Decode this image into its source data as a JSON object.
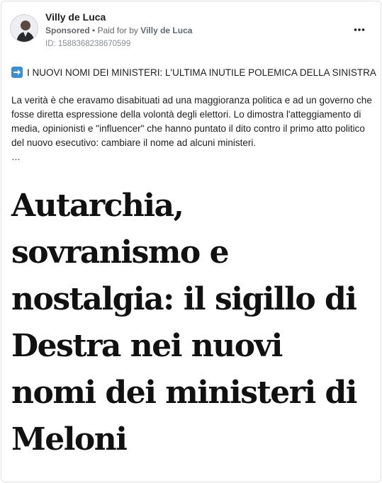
{
  "post": {
    "author": "Villy de Luca",
    "sponsored_label": "Sponsored",
    "paid_for_prefix": "Paid for by",
    "paid_for_name": "Villy de Luca",
    "ad_id": "ID: 1588368238670599",
    "more_icon": "more-horizontal-icon",
    "more_label": "•••",
    "headline_icon": "right-arrow-emoji-icon",
    "headline": "I NUOVI NOMI DEI MINISTERI: L'ULTIMA INUTILE POLEMICA DELLA SINISTRA",
    "body": "La verità è che eravamo disabituati ad una maggioranza politica e ad un governo che fosse diretta espressione della volontà degli elettori. Lo dimostra l'atteggiamento di media, opinionisti e \"influencer\" che hanno puntato il dito contro il primo atto politico del nuovo esecutivo: cambiare il nome ad alcuni ministeri.",
    "ellipsis": "…"
  },
  "creative": {
    "lines": [
      "Autarchia,",
      "sovranismo e",
      "nostalgia: il sigillo di",
      "Destra nei nuovi",
      "nomi dei ministeri di",
      "Meloni"
    ]
  },
  "colors": {
    "accent_blue": "#3b8ed0",
    "meta_gray": "#65676b",
    "text": "#1c1e21"
  }
}
